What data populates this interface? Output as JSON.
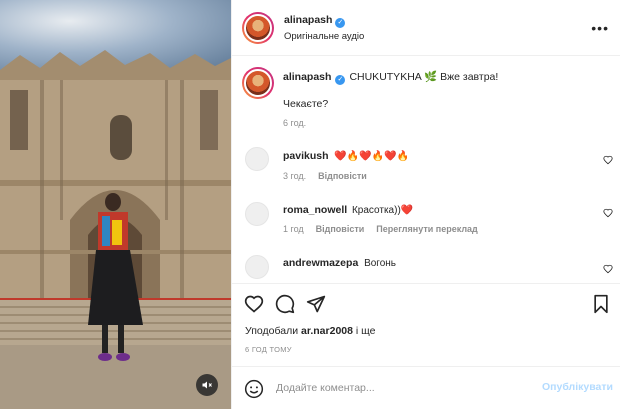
{
  "post": {
    "author": "alinapash",
    "audio": "Оригінальне аудіо",
    "more_label": "•••"
  },
  "caption": {
    "author": "alinapash",
    "text": "CHUKUTYKHA 🌿 Вже завтра!",
    "second_line": "Чекаєте?",
    "time": "6 год."
  },
  "comments": [
    {
      "user": "pavikush",
      "text": "❤️🔥❤️🔥❤️🔥",
      "time": "3 год.",
      "reply": "Відповісти",
      "extra": ""
    },
    {
      "user": "roma_nowell",
      "text": "Красотка))❤️",
      "time": "1 год",
      "reply": "Відповісти",
      "extra": "Переглянути переклад"
    },
    {
      "user": "andrewmazepa",
      "text": "Вогонь",
      "time": "",
      "reply": "",
      "extra": ""
    }
  ],
  "likes": {
    "prefix": "Уподобали",
    "user": "ar.nar2008",
    "suffix": "і ще"
  },
  "timestamp": "6 ГОД ТОМУ",
  "add_comment": {
    "placeholder": "Додайте коментар...",
    "publish": "Опублікувати"
  },
  "colors": {
    "verified": "#3897f0",
    "publish_disabled": "#b3dbff",
    "muted_text": "#8e8e8e"
  }
}
